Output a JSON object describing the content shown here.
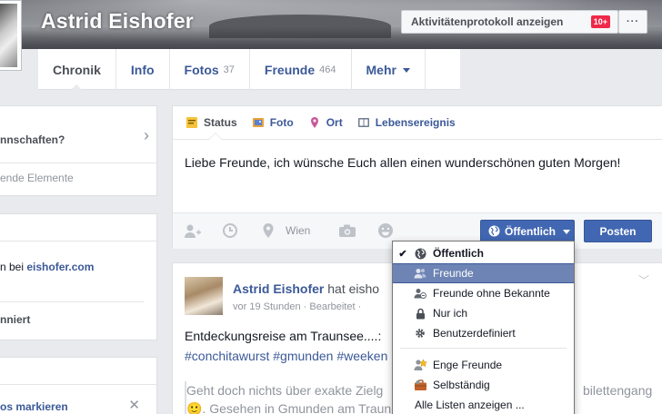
{
  "profile": {
    "name": "Astrid Eishofer",
    "activity_log_label": "Aktivitätenprotokoll anzeigen",
    "activity_badge": "10+",
    "more_label": "···"
  },
  "nav": {
    "timeline": "Chronik",
    "info": "Info",
    "photos": "Fotos",
    "photos_count": "37",
    "friends": "Freunde",
    "friends_count": "464",
    "more": "Mehr"
  },
  "left": {
    "card1_question": "nnschaften?",
    "card1_sub": "ende Elemente",
    "card2_line1_prefix": "n bei ",
    "card2_line1_link": "eishofer.com",
    "card2_line2": "nniert",
    "card3_line1": "os markieren"
  },
  "composer": {
    "tabs": {
      "status": "Status",
      "photo": "Foto",
      "place": "Ort",
      "life_event": "Lebensereignis"
    },
    "text": "Liebe Freunde, ich wünsche Euch allen einen wunderschönen guten Morgen!",
    "location_value": "Wien",
    "privacy_label": "Öffentlich",
    "post_label": "Posten"
  },
  "privacy_menu": {
    "items": [
      {
        "label": "Öffentlich",
        "checked": true
      },
      {
        "label": "Freunde",
        "selected": true
      },
      {
        "label": "Freunde ohne Bekannte"
      },
      {
        "label": "Nur ich"
      },
      {
        "label": "Benutzerdefiniert"
      },
      {
        "label": "Enge Freunde"
      },
      {
        "label": "Selbständig"
      },
      {
        "label": "Alle Listen anzeigen ..."
      }
    ]
  },
  "post": {
    "author": "Astrid Eishofer",
    "action": " hat eisho",
    "meta": "vor 19 Stunden · Bearbeitet ·",
    "line1": "Entdeckungsreise am Traunsee....:",
    "line2": "#conchitawurst #gmunden #weeken",
    "quote": "Geht doch nichts über exakte Zielg",
    "quote_tail": "bilettengang",
    "quote2": "🙂. Gesehen in Gmunden am Traun"
  },
  "colors": {
    "accent": "#4267b2",
    "link": "#3b5998",
    "badge": "#f02849",
    "menu_selected": "#6d84b4"
  }
}
